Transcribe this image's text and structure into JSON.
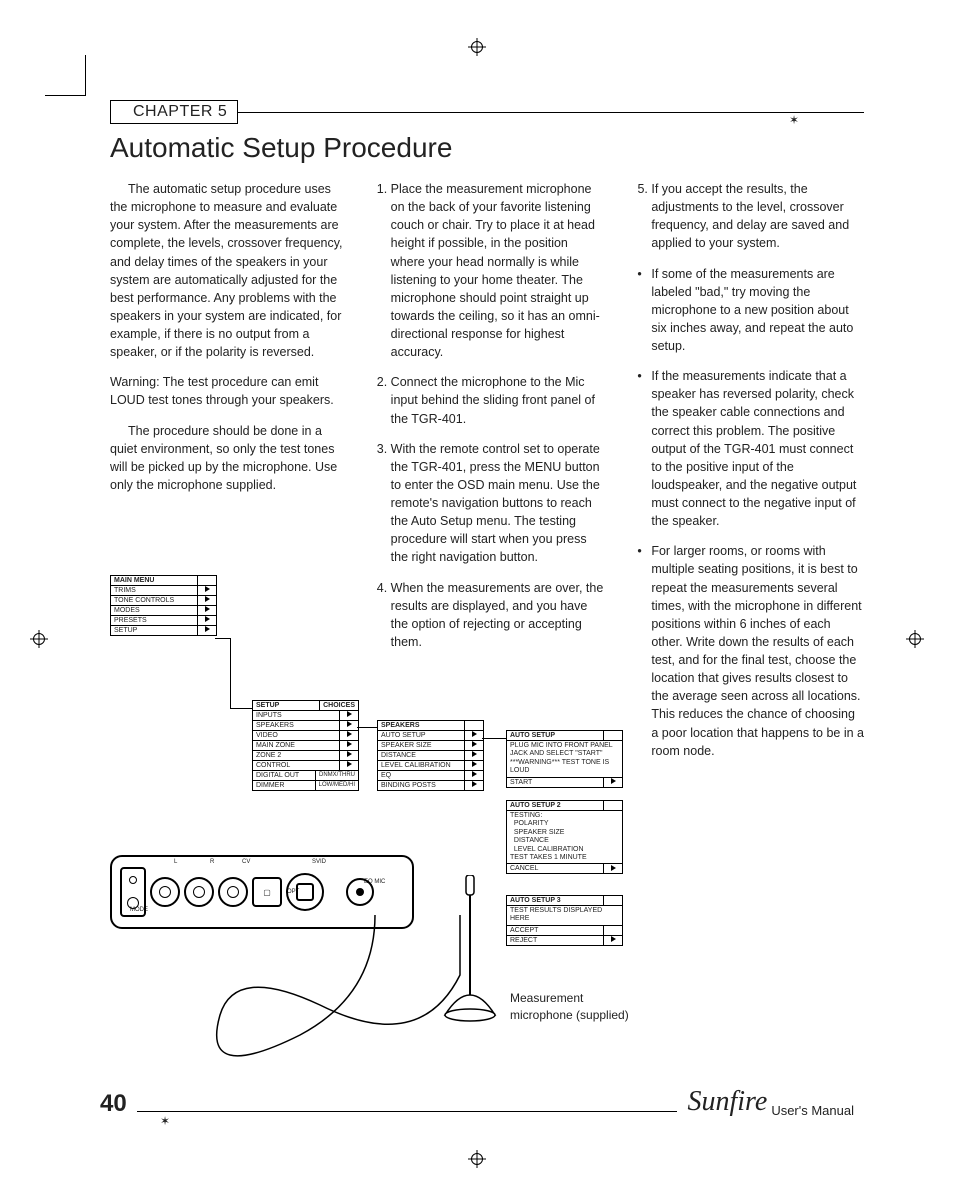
{
  "chapter": "CHAPTER 5",
  "title": "Automatic Setup Procedure",
  "col1": {
    "p1": "The automatic setup procedure uses the microphone to measure and evaluate your system. After the measurements are complete, the levels, crossover frequency, and delay times of the speakers in your system are automatically adjusted for the best performance. Any problems with the speakers in your system are indicated, for example, if there is no output from a speaker, or if the polarity is reversed.",
    "p2": "Warning: The test procedure can emit LOUD test tones through your speakers.",
    "p3": "The procedure should be done in a quiet environment, so only the test tones will be picked up by the microphone. Use only the microphone supplied."
  },
  "steps": {
    "s1": "Place the measurement microphone on the back of your favorite listening couch or chair. Try to place it at head height if possible, in the position where your head normally is while listening to your home theater. The microphone should point straight up towards the ceiling, so it has an omni-directional response for highest accuracy.",
    "s2": "Connect the microphone to the Mic input behind the sliding front panel of the TGR-401.",
    "s3": "With the remote control set to operate the TGR-401, press the MENU button to enter the OSD main menu. Use the remote's navigation buttons to reach the Auto Setup menu. The testing procedure will start when you press the right navigation button.",
    "s4": "When the measurements are over, the results are displayed, and you have the option of rejecting or accepting them.",
    "s5": "If you accept the results, the adjustments to the level, crossover frequency, and delay are saved and applied to your system."
  },
  "bullets": {
    "b1": "If some of the measurements are labeled \"bad,\" try moving the microphone to a new position about six inches away, and repeat the auto setup.",
    "b2": "If the measurements indicate that a speaker has reversed polarity, check the speaker cable connections and correct this problem. The positive output of the TGR-401 must connect to the positive input of the loudspeaker, and the negative output must connect to the negative input of the speaker.",
    "b3": "For larger rooms, or rooms with multiple seating positions, it is best to repeat the measurements several times, with the microphone in different positions within 6 inches of each other. Write down the results of each test, and for the final test, choose the location that gives results closest to the average seen across all locations. This reduces the chance of choosing a poor location that happens to be in a room node."
  },
  "menus": {
    "main": {
      "title": "MAIN MENU",
      "items": [
        "TRIMS",
        "TONE CONTROLS",
        "MODES",
        "PRESETS",
        "SETUP"
      ]
    },
    "setup": {
      "title": "SETUP",
      "col2": "CHOICES",
      "rows": [
        {
          "l": "INPUTS",
          "r": "arrow"
        },
        {
          "l": "SPEAKERS",
          "r": "arrow"
        },
        {
          "l": "VIDEO",
          "r": "arrow"
        },
        {
          "l": "MAIN ZONE",
          "r": "arrow"
        },
        {
          "l": "ZONE 2",
          "r": "arrow"
        },
        {
          "l": "CONTROL",
          "r": "arrow"
        },
        {
          "l": "DIGITAL OUT",
          "r": "DNMX/THRU"
        },
        {
          "l": "DIMMER",
          "r": "LOW/MED/HI"
        }
      ]
    },
    "speakers": {
      "title": "SPEAKERS",
      "items": [
        "AUTO SETUP",
        "SPEAKER SIZE",
        "DISTANCE",
        "LEVEL CALIBRATION",
        "EQ",
        "BINDING POSTS"
      ]
    },
    "auto1": {
      "title": "AUTO SETUP",
      "note": "PLUG MIC INTO FRONT PANEL JACK AND SELECT \"START\" ***WARNING*** TEST TONE IS LOUD",
      "action": "START"
    },
    "auto2": {
      "title": "AUTO SETUP 2",
      "note": "TESTING:\n  POLARITY\n  SPEAKER SIZE\n  DISTANCE\n  LEVEL CALIBRATION\nTEST TAKES 1 MINUTE",
      "action": "CANCEL"
    },
    "auto3": {
      "title": "AUTO SETUP 3",
      "note": "TEST RESULTS DISPLAYED HERE",
      "a1": "ACCEPT",
      "a2": "REJECT"
    }
  },
  "mic_label": "Measurement microphone (supplied)",
  "device": {
    "mode": "MODE",
    "l": "L",
    "r": "R",
    "cv": "CV",
    "svid": "SVID",
    "opt": "OPT",
    "eqmic": "EQ MIC"
  },
  "footer": {
    "page": "40",
    "brand": "Sunfire",
    "manual": "User's Manual"
  }
}
